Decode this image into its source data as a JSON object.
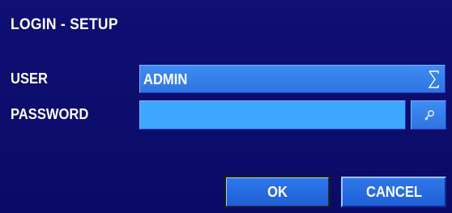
{
  "dialog": {
    "title": "LOGIN  -  SETUP"
  },
  "form": {
    "user_label": "USER",
    "user_value": "ADMIN",
    "password_label": "PASSWORD",
    "password_value": ""
  },
  "buttons": {
    "ok_label": "OK",
    "cancel_label": "CANCEL"
  },
  "icons": {
    "user_dropdown": "dropdown-sigma-icon",
    "password_keypad": "key-icon"
  },
  "colors": {
    "background": "#0b0c6b",
    "field": "#3a85ef",
    "password_field": "#3da6ff",
    "text": "#ffffff"
  }
}
